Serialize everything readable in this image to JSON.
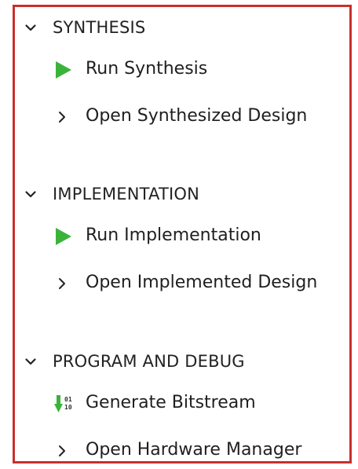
{
  "flow": {
    "sections": [
      {
        "title": "SYNTHESIS",
        "items": [
          {
            "label": "Run Synthesis",
            "icon": "run-icon"
          },
          {
            "label": "Open Synthesized Design",
            "icon": "chevron-right-icon"
          }
        ]
      },
      {
        "title": "IMPLEMENTATION",
        "items": [
          {
            "label": "Run Implementation",
            "icon": "run-icon"
          },
          {
            "label": "Open Implemented Design",
            "icon": "chevron-right-icon"
          }
        ]
      },
      {
        "title": "PROGRAM AND DEBUG",
        "items": [
          {
            "label": "Generate Bitstream",
            "icon": "bitstream-icon"
          },
          {
            "label": "Open Hardware Manager",
            "icon": "chevron-right-icon"
          }
        ]
      }
    ]
  },
  "colors": {
    "frame": "#c9302c",
    "run": "#3bb33b",
    "text": "#1f1f1f"
  }
}
